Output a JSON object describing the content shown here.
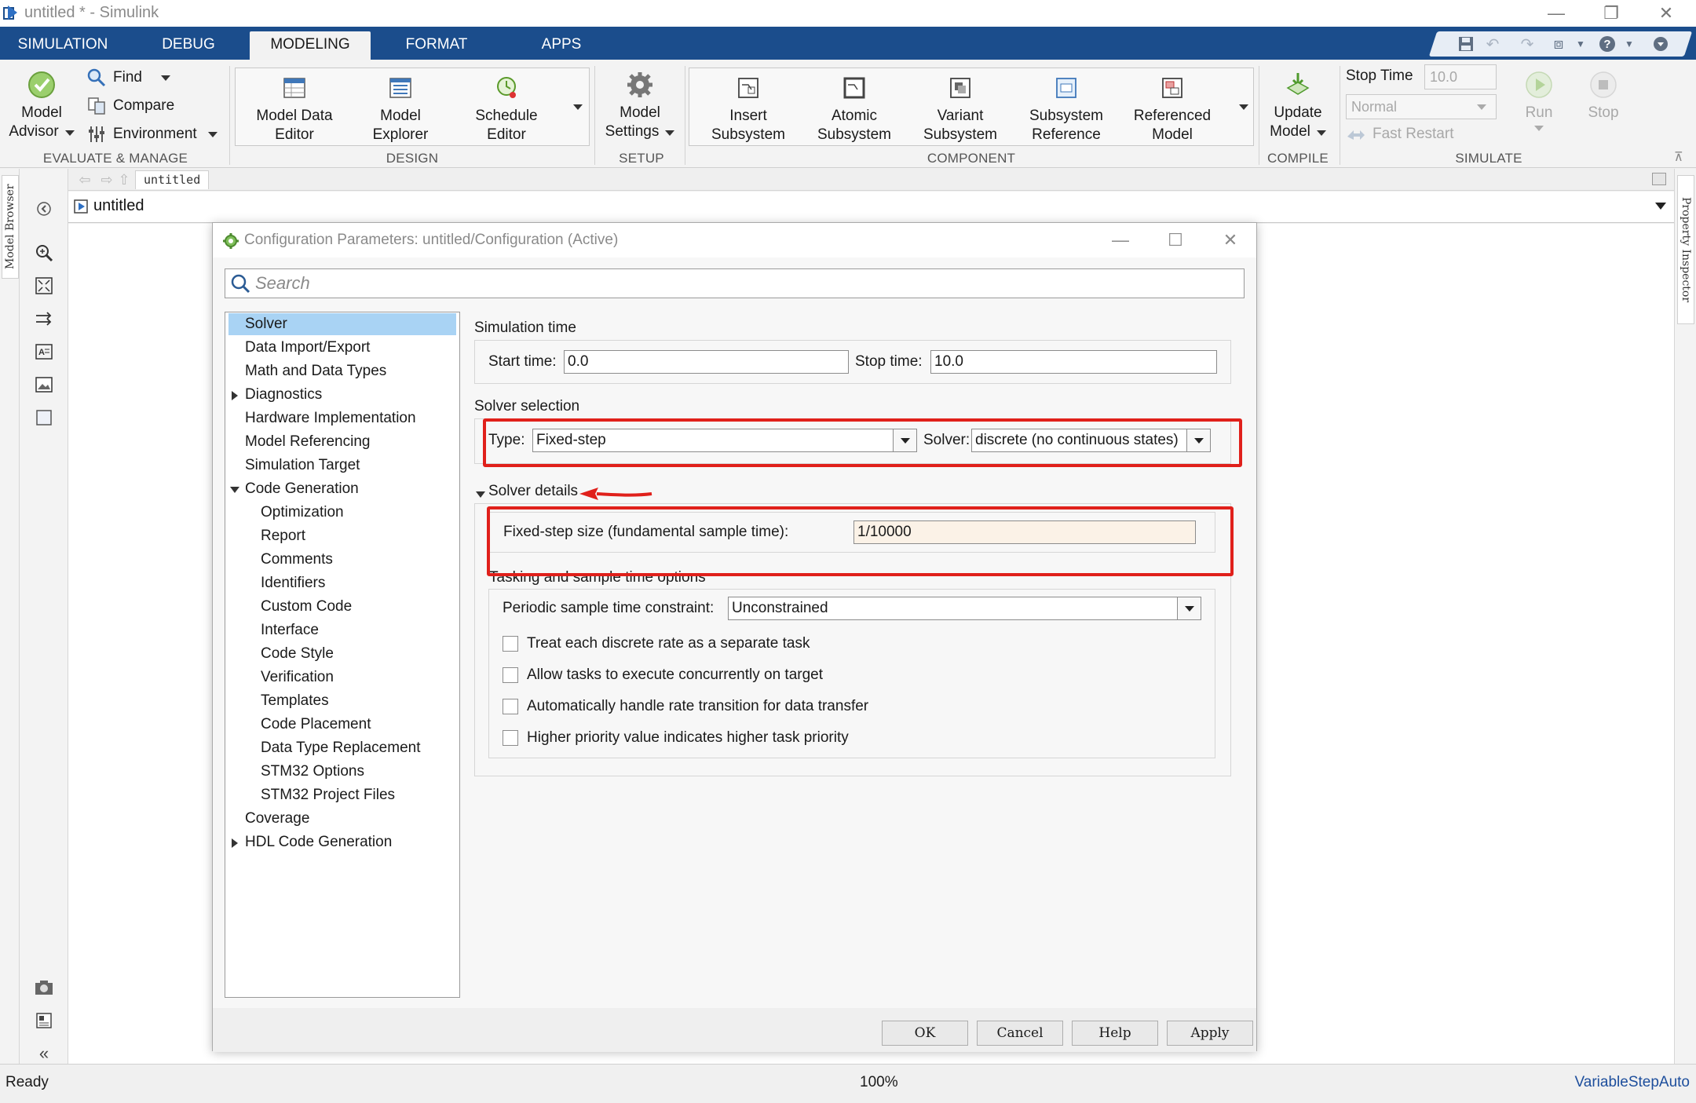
{
  "window": {
    "title": "untitled * - Simulink"
  },
  "ribbon_tabs": [
    {
      "label": "SIMULATION"
    },
    {
      "label": "DEBUG"
    },
    {
      "label": "MODELING"
    },
    {
      "label": "FORMAT"
    },
    {
      "label": "APPS"
    }
  ],
  "active_tab": "MODELING",
  "ribbon": {
    "evaluate": {
      "model_advisor": "Model\nAdvisor",
      "model_advisor_l1": "Model",
      "model_advisor_l2": "Advisor",
      "find": "Find",
      "compare": "Compare",
      "environment": "Environment",
      "group_label": "EVALUATE & MANAGE"
    },
    "design": {
      "model_data_editor_l1": "Model Data",
      "model_data_editor_l2": "Editor",
      "model_explorer_l1": "Model",
      "model_explorer_l2": "Explorer",
      "schedule_editor_l1": "Schedule",
      "schedule_editor_l2": "Editor",
      "group_label": "DESIGN"
    },
    "setup": {
      "model_settings_l1": "Model",
      "model_settings_l2": "Settings",
      "group_label": "SETUP"
    },
    "component": {
      "insert_l1": "Insert",
      "insert_l2": "Subsystem",
      "atomic_l1": "Atomic",
      "atomic_l2": "Subsystem",
      "variant_l1": "Variant",
      "variant_l2": "Subsystem",
      "subref_l1": "Subsystem",
      "subref_l2": "Reference",
      "refmodel_l1": "Referenced",
      "refmodel_l2": "Model",
      "group_label": "COMPONENT"
    },
    "compile": {
      "update_l1": "Update",
      "update_l2": "Model",
      "group_label": "COMPILE"
    },
    "simulate": {
      "stop_time_label": "Stop Time",
      "stop_time_value": "10.0",
      "mode_value": "Normal",
      "fast_restart": "Fast Restart",
      "run": "Run",
      "stop": "Stop",
      "group_label": "SIMULATE"
    }
  },
  "left_dock": {
    "model_browser": "Model Browser"
  },
  "right_dock": {
    "property_inspector": "Property Inspector"
  },
  "editor": {
    "breadcrumb": "untitled",
    "model_name": "untitled"
  },
  "status": {
    "left": "Ready",
    "zoom": "100%",
    "solver": "VariableStepAuto"
  },
  "dialog": {
    "title": "Configuration Parameters: untitled/Configuration (Active)",
    "search_placeholder": "Search",
    "tree": [
      {
        "label": "Solver",
        "level": 0,
        "selected": true
      },
      {
        "label": "Data Import/Export",
        "level": 0
      },
      {
        "label": "Math and Data Types",
        "level": 0
      },
      {
        "label": "Diagnostics",
        "level": 0,
        "expander": "collapsed"
      },
      {
        "label": "Hardware Implementation",
        "level": 0
      },
      {
        "label": "Model Referencing",
        "level": 0
      },
      {
        "label": "Simulation Target",
        "level": 0
      },
      {
        "label": "Code Generation",
        "level": 0,
        "expander": "expanded"
      },
      {
        "label": "Optimization",
        "level": 1
      },
      {
        "label": "Report",
        "level": 1
      },
      {
        "label": "Comments",
        "level": 1
      },
      {
        "label": "Identifiers",
        "level": 1
      },
      {
        "label": "Custom Code",
        "level": 1
      },
      {
        "label": "Interface",
        "level": 1
      },
      {
        "label": "Code Style",
        "level": 1
      },
      {
        "label": "Verification",
        "level": 1
      },
      {
        "label": "Templates",
        "level": 1
      },
      {
        "label": "Code Placement",
        "level": 1
      },
      {
        "label": "Data Type Replacement",
        "level": 1
      },
      {
        "label": "STM32 Options",
        "level": 1
      },
      {
        "label": "STM32 Project Files",
        "level": 1
      },
      {
        "label": "Coverage",
        "level": 0
      },
      {
        "label": "HDL Code Generation",
        "level": 0,
        "expander": "collapsed"
      }
    ],
    "solver": {
      "sim_time_heading": "Simulation time",
      "start_time_label": "Start time:",
      "start_time_value": "0.0",
      "stop_time_label": "Stop time:",
      "stop_time_value": "10.0",
      "solver_selection_heading": "Solver selection",
      "type_label": "Type:",
      "type_value": "Fixed-step",
      "solver_label": "Solver:",
      "solver_value": "discrete (no continuous states)",
      "details_heading": "Solver details",
      "fixed_step_label": "Fixed-step size (fundamental sample time):",
      "fixed_step_value": "1/10000",
      "tasking_heading": "Tasking and sample time options",
      "periodic_label": "Periodic sample time constraint:",
      "periodic_value": "Unconstrained",
      "checkboxes": [
        {
          "label": "Treat each discrete rate as a separate task",
          "checked": false
        },
        {
          "label": "Allow tasks to execute concurrently on target",
          "checked": false
        },
        {
          "label": "Automatically handle rate transition for data transfer",
          "checked": false
        },
        {
          "label": "Higher priority value indicates higher task priority",
          "checked": false
        }
      ]
    },
    "buttons": {
      "ok": "OK",
      "cancel": "Cancel",
      "help": "Help",
      "apply": "Apply"
    }
  },
  "colors": {
    "ribbon_tab_bg": "#1b4d8c",
    "selection": "#a9d3f4",
    "annotation_red": "#e0201b",
    "status_link": "#1d4e9c"
  }
}
